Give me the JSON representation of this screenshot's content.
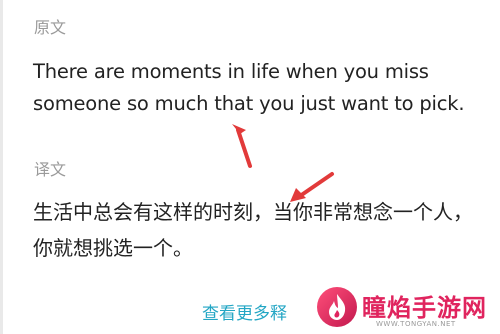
{
  "original": {
    "label": "原文",
    "text": "There are moments in life when you miss someone so much that you just want to pick."
  },
  "translation": {
    "label": "译文",
    "text": "生活中总会有这样的时刻，当你非常想念一个人，你就想挑选一个。"
  },
  "more_link": "查看更多释",
  "watermark": {
    "title": "瞳焰手游网",
    "subtitle": "WWW.TONGYAN.NET"
  },
  "colors": {
    "label": "#9a9a9a",
    "text": "#222222",
    "link": "#23a6c4",
    "arrow": "#e23a3a",
    "brand": "#e0245e"
  },
  "icons": [
    "arrow-annotation-icon",
    "flame-logo-icon"
  ]
}
